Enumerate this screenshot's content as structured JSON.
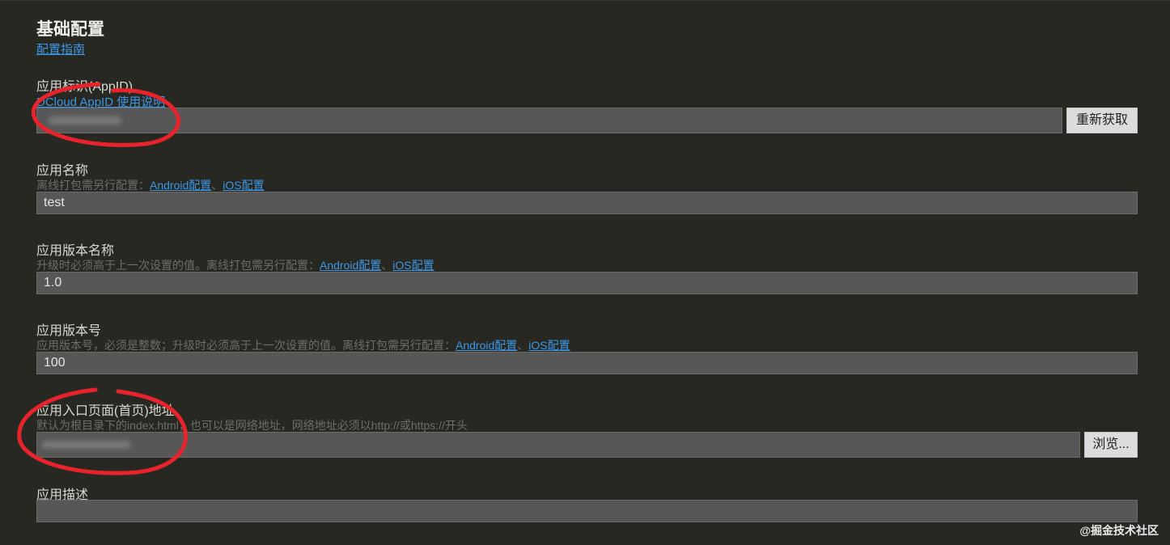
{
  "section": {
    "title": "基础配置",
    "guide_link": "配置指南"
  },
  "fields": {
    "appid": {
      "label": "应用标识(AppID)",
      "hint_link": "DCloud AppID 使用说明",
      "value": "",
      "button": "重新获取"
    },
    "name": {
      "label": "应用名称",
      "hint_text": "离线打包需另行配置：",
      "android_link": "Android配置",
      "separator": "、",
      "ios_link": "iOS配置",
      "value": "test"
    },
    "version_name": {
      "label": "应用版本名称",
      "hint_text": "升级时必须高于上一次设置的值。离线打包需另行配置：",
      "android_link": "Android配置",
      "separator": "、",
      "ios_link": "iOS配置",
      "value": "1.0"
    },
    "version_code": {
      "label": "应用版本号",
      "hint_text": "应用版本号，必须是整数；升级时必须高于上一次设置的值。离线打包需另行配置：",
      "android_link": "Android配置",
      "separator": "、",
      "ios_link": "iOS配置",
      "value": "100"
    },
    "entry_page": {
      "label": "应用入口页面(首页)地址",
      "hint_text": "默认为根目录下的index.html；也可以是网络地址，网络地址必须以http://或https://开头",
      "value": "",
      "button": "浏览..."
    },
    "description": {
      "label": "应用描述",
      "value": ""
    }
  },
  "annotation_color": "#e8232b",
  "watermark": "@掘金技术社区"
}
